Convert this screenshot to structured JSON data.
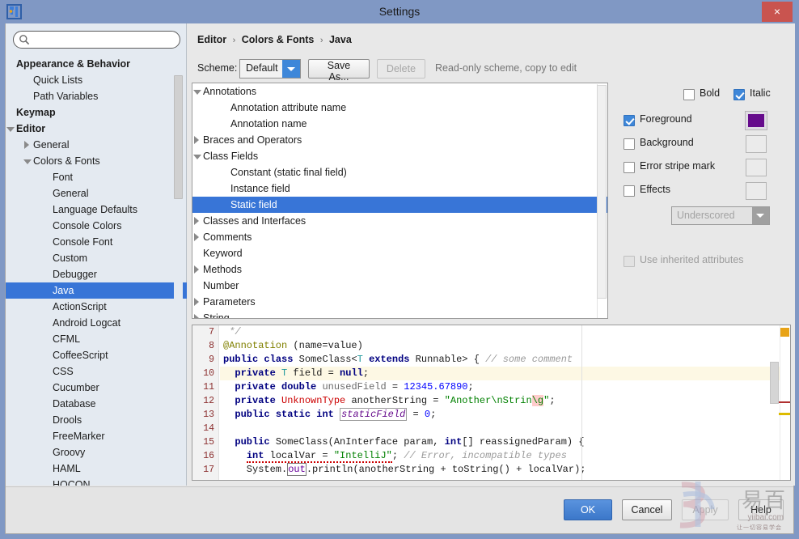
{
  "window": {
    "title": "Settings",
    "app_icon": "intellij-idea-icon",
    "close_label": "×"
  },
  "sidebar": {
    "search": {
      "placeholder": "",
      "value": "",
      "icon": "search-icon"
    },
    "items": [
      {
        "label": "Appearance & Behavior",
        "indent": 10,
        "bold": true,
        "twisty": "none",
        "selected": false
      },
      {
        "label": "Quick Lists",
        "indent": 34,
        "bold": false,
        "twisty": "none",
        "selected": false
      },
      {
        "label": "Path Variables",
        "indent": 34,
        "bold": false,
        "twisty": "none",
        "selected": false
      },
      {
        "label": "Keymap",
        "indent": 10,
        "bold": true,
        "twisty": "none",
        "selected": false
      },
      {
        "label": "Editor",
        "indent": 10,
        "bold": true,
        "twisty": "down",
        "selected": false
      },
      {
        "label": "General",
        "indent": 34,
        "bold": false,
        "twisty": "right",
        "selected": false
      },
      {
        "label": "Colors & Fonts",
        "indent": 34,
        "bold": false,
        "twisty": "down",
        "selected": false
      },
      {
        "label": "Font",
        "indent": 58,
        "bold": false,
        "twisty": "none",
        "selected": false
      },
      {
        "label": "General",
        "indent": 58,
        "bold": false,
        "twisty": "none",
        "selected": false
      },
      {
        "label": "Language Defaults",
        "indent": 58,
        "bold": false,
        "twisty": "none",
        "selected": false
      },
      {
        "label": "Console Colors",
        "indent": 58,
        "bold": false,
        "twisty": "none",
        "selected": false
      },
      {
        "label": "Console Font",
        "indent": 58,
        "bold": false,
        "twisty": "none",
        "selected": false
      },
      {
        "label": "Custom",
        "indent": 58,
        "bold": false,
        "twisty": "none",
        "selected": false
      },
      {
        "label": "Debugger",
        "indent": 58,
        "bold": false,
        "twisty": "none",
        "selected": false
      },
      {
        "label": "Java",
        "indent": 58,
        "bold": false,
        "twisty": "none",
        "selected": true
      },
      {
        "label": "ActionScript",
        "indent": 58,
        "bold": false,
        "twisty": "none",
        "selected": false
      },
      {
        "label": "Android Logcat",
        "indent": 58,
        "bold": false,
        "twisty": "none",
        "selected": false
      },
      {
        "label": "CFML",
        "indent": 58,
        "bold": false,
        "twisty": "none",
        "selected": false
      },
      {
        "label": "CoffeeScript",
        "indent": 58,
        "bold": false,
        "twisty": "none",
        "selected": false
      },
      {
        "label": "CSS",
        "indent": 58,
        "bold": false,
        "twisty": "none",
        "selected": false
      },
      {
        "label": "Cucumber",
        "indent": 58,
        "bold": false,
        "twisty": "none",
        "selected": false
      },
      {
        "label": "Database",
        "indent": 58,
        "bold": false,
        "twisty": "none",
        "selected": false
      },
      {
        "label": "Drools",
        "indent": 58,
        "bold": false,
        "twisty": "none",
        "selected": false
      },
      {
        "label": "FreeMarker",
        "indent": 58,
        "bold": false,
        "twisty": "none",
        "selected": false
      },
      {
        "label": "Groovy",
        "indent": 58,
        "bold": false,
        "twisty": "none",
        "selected": false
      },
      {
        "label": "HAML",
        "indent": 58,
        "bold": false,
        "twisty": "none",
        "selected": false
      },
      {
        "label": "HOCON",
        "indent": 58,
        "bold": false,
        "twisty": "none",
        "selected": false
      }
    ]
  },
  "breadcrumb": {
    "part1": "Editor",
    "part2": "Colors & Fonts",
    "part3": "Java",
    "separator": "›"
  },
  "scheme_bar": {
    "label": "Scheme:",
    "selected": "Default",
    "save_as_label": "Save As...",
    "delete_label": "Delete",
    "hint": "Read-only scheme, copy to edit"
  },
  "color_tree": {
    "items": [
      {
        "label": "Annotations",
        "indent": 10,
        "twisty": "down",
        "selected": false
      },
      {
        "label": "Annotation attribute name",
        "indent": 44,
        "twisty": "none",
        "selected": false
      },
      {
        "label": "Annotation name",
        "indent": 44,
        "twisty": "none",
        "selected": false
      },
      {
        "label": "Braces and Operators",
        "indent": 10,
        "twisty": "right",
        "selected": false
      },
      {
        "label": "Class Fields",
        "indent": 10,
        "twisty": "down",
        "selected": false
      },
      {
        "label": "Constant (static final field)",
        "indent": 44,
        "twisty": "none",
        "selected": false
      },
      {
        "label": "Instance field",
        "indent": 44,
        "twisty": "none",
        "selected": false
      },
      {
        "label": "Static field",
        "indent": 44,
        "twisty": "none",
        "selected": true
      },
      {
        "label": "Classes and Interfaces",
        "indent": 10,
        "twisty": "right",
        "selected": false
      },
      {
        "label": "Comments",
        "indent": 10,
        "twisty": "right",
        "selected": false
      },
      {
        "label": "Keyword",
        "indent": 10,
        "twisty": "none",
        "selected": false
      },
      {
        "label": "Methods",
        "indent": 10,
        "twisty": "right",
        "selected": false
      },
      {
        "label": "Number",
        "indent": 10,
        "twisty": "none",
        "selected": false
      },
      {
        "label": "Parameters",
        "indent": 10,
        "twisty": "right",
        "selected": false
      },
      {
        "label": "String",
        "indent": 10,
        "twisty": "right",
        "selected": false
      }
    ]
  },
  "attributes": {
    "bold": {
      "label": "Bold",
      "checked": false
    },
    "italic": {
      "label": "Italic",
      "checked": true
    },
    "foreground": {
      "label": "Foreground",
      "checked": true,
      "color": "#660b8c"
    },
    "background": {
      "label": "Background",
      "checked": false,
      "color": ""
    },
    "error_stripe": {
      "label": "Error stripe mark",
      "checked": false,
      "color": ""
    },
    "effects": {
      "label": "Effects",
      "checked": false,
      "color": ""
    },
    "effects_type": "Underscored",
    "use_inherited": {
      "label": "Use inherited attributes",
      "checked": false,
      "enabled": false
    }
  },
  "preview": {
    "line_numbers": [
      "7",
      "8",
      "9",
      "10",
      "11",
      "12",
      "13",
      "14",
      "15",
      "16",
      "17"
    ],
    "highlight_line_index": 3,
    "lines": [
      " */",
      "@Annotation (name=value)",
      "public class SomeClass<T extends Runnable> { // some comment",
      "  private T field = null;",
      "  private double unusedField = 12345.67890;",
      "  private UnknownType anotherString = \"Another\\nStrin\\g\";",
      "  public static int staticField = 0;",
      "",
      "  public SomeClass(AnInterface param, int[] reassignedParam) {",
      "    int localVar = \"IntelliJ\"; // Error, incompatible types",
      "    System.out.println(anotherString + toString() + localVar);"
    ]
  },
  "buttons": {
    "ok": "OK",
    "cancel": "Cancel",
    "apply": "Apply",
    "help": "Help"
  },
  "watermark": {
    "cjk": "易百",
    "domain": "yiibai.com",
    "tagline": "让一切容易学会"
  }
}
